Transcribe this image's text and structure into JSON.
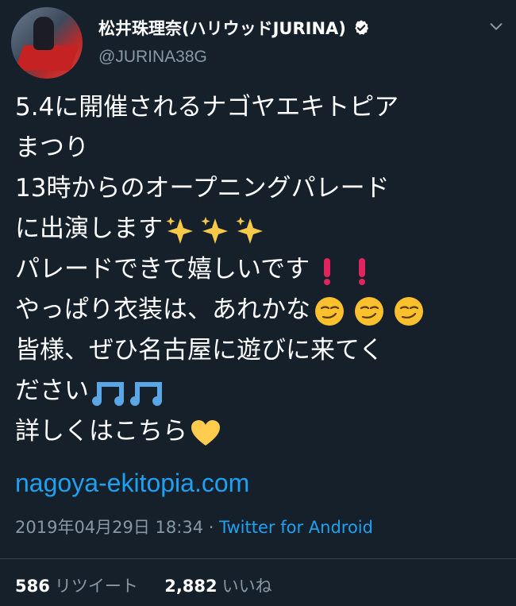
{
  "user": {
    "display_name": "松井珠理奈(ハリウッドJURINA)",
    "handle": "@JURINA38G",
    "verified": true
  },
  "tweet": {
    "lines": [
      "5.4に開催されるナゴヤエキトピア",
      "まつり",
      "13時からのオープニングパレード",
      "に出演します",
      "パレードできて嬉しいです",
      "やっぱり衣装は、あれかな",
      "皆様、ぜひ名古屋に遊びに来てく",
      "ださい",
      "詳しくはこちら"
    ],
    "link": "nagoya-ekitopia.com",
    "timestamp": "2019年04月29日 18:34",
    "separator": "·",
    "source": "Twitter for Android"
  },
  "stats": {
    "retweets_count": "586",
    "retweets_label": "リツイート",
    "likes_count": "2,882",
    "likes_label": "いいね"
  },
  "icons": {
    "verified": "verified-badge-icon",
    "menu": "chevron-down-icon",
    "sparkles": "sparkles-icon",
    "exclamation": "red-exclamation-icon",
    "smirk": "smirking-face-icon",
    "notes": "musical-notes-icon",
    "heart": "yellow-heart-icon"
  },
  "colors": {
    "background": "#15202b",
    "link": "#1da1f2",
    "muted": "#8899a6",
    "divider": "#38444d"
  }
}
